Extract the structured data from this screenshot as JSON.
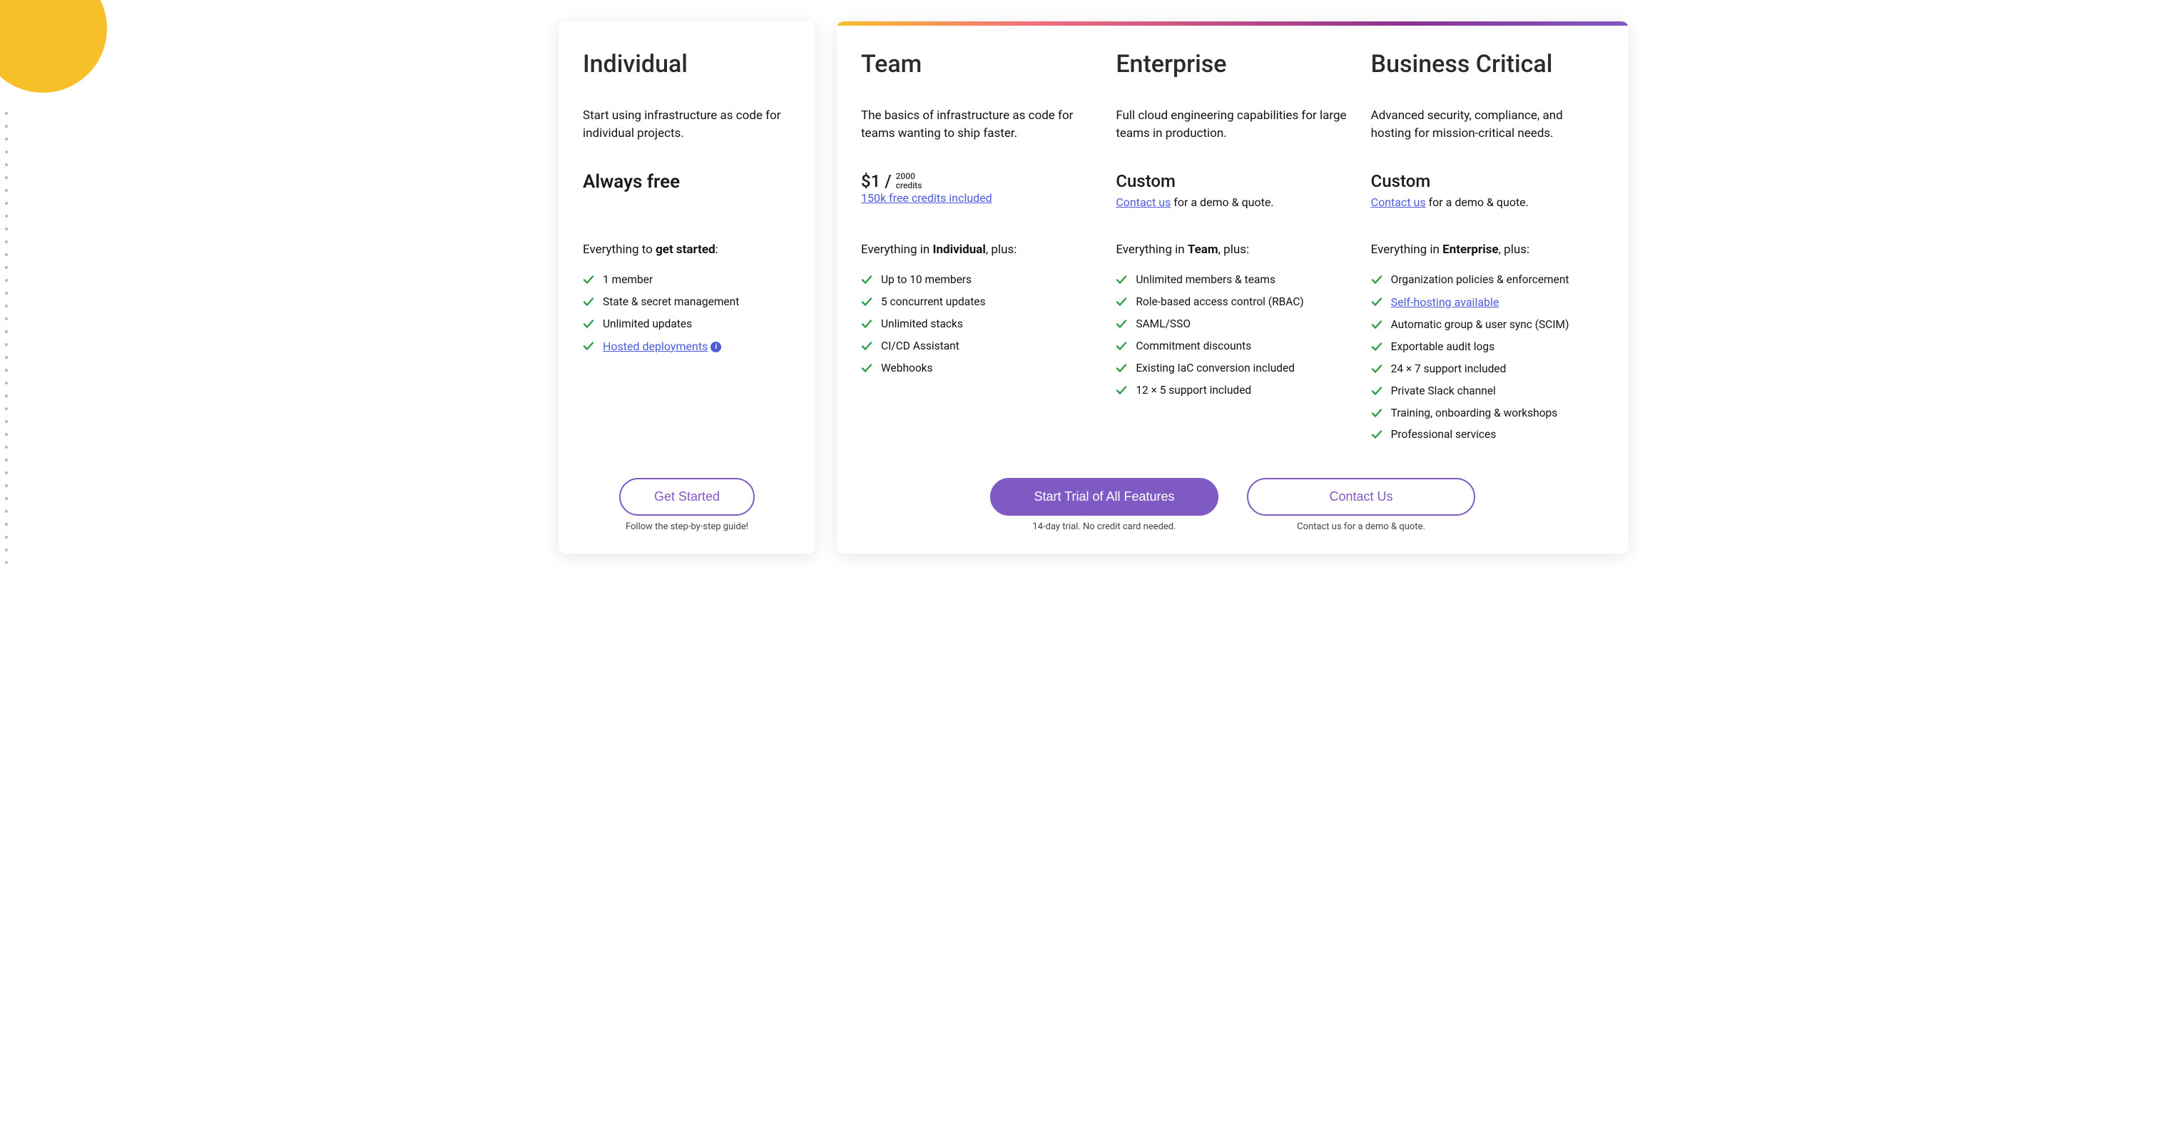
{
  "plans": {
    "individual": {
      "name": "Individual",
      "desc": "Start using infrastructure as code for individual projects.",
      "price_label": "Always free",
      "everything_prefix": "Everything to ",
      "everything_bold": "get started",
      "everything_suffix": ":",
      "features": [
        {
          "text": "1 member"
        },
        {
          "text": "State & secret management"
        },
        {
          "text": "Unlimited updates"
        },
        {
          "text": "Hosted deployments",
          "link": true,
          "info": true
        }
      ],
      "cta": "Get Started",
      "cta_sub": "Follow the step-by-step guide!"
    },
    "team": {
      "name": "Team",
      "desc": "The basics of infrastructure as code for teams wanting to ship faster.",
      "price_main": "$1 /",
      "price_unit_top": "2000",
      "price_unit_bottom": "credits",
      "price_link": "150k free credits included",
      "everything_prefix": "Everything in ",
      "everything_bold": "Individual",
      "everything_suffix": ", plus:",
      "features": [
        {
          "text": "Up to 10 members"
        },
        {
          "text": "5 concurrent updates"
        },
        {
          "text": "Unlimited stacks"
        },
        {
          "text": "CI/CD Assistant"
        },
        {
          "text": "Webhooks"
        }
      ]
    },
    "enterprise": {
      "name": "Enterprise",
      "desc": "Full cloud engineering capabilities for large teams in production.",
      "price_custom": "Custom",
      "contact_link": "Contact us",
      "contact_rest": " for a demo & quote.",
      "everything_prefix": "Everything in ",
      "everything_bold": "Team",
      "everything_suffix": ", plus:",
      "features": [
        {
          "text": "Unlimited members & teams"
        },
        {
          "text": "Role-based access control (RBAC)"
        },
        {
          "text": "SAML/SSO"
        },
        {
          "text": "Commitment discounts"
        },
        {
          "text": "Existing IaC conversion included"
        },
        {
          "text": "12 × 5 support included"
        }
      ]
    },
    "business": {
      "name": "Business Critical",
      "desc": "Advanced security, compliance, and hosting for mission-critical needs.",
      "price_custom": "Custom",
      "contact_link": "Contact us",
      "contact_rest": " for a demo & quote.",
      "everything_prefix": "Everything in ",
      "everything_bold": "Enterprise",
      "everything_suffix": ", plus:",
      "features": [
        {
          "text": "Organization policies & enforcement"
        },
        {
          "text": "Self-hosting available",
          "link": true
        },
        {
          "text": "Automatic group & user sync (SCIM)"
        },
        {
          "text": "Exportable audit logs"
        },
        {
          "text": "24 × 7 support included"
        },
        {
          "text": "Private Slack channel"
        },
        {
          "text": "Training, onboarding & workshops"
        },
        {
          "text": "Professional services"
        }
      ]
    }
  },
  "cta": {
    "trial_button": "Start Trial of All Features",
    "trial_sub": "14-day trial. No credit card needed.",
    "contact_button": "Contact Us",
    "contact_sub": "Contact us for a demo & quote."
  }
}
